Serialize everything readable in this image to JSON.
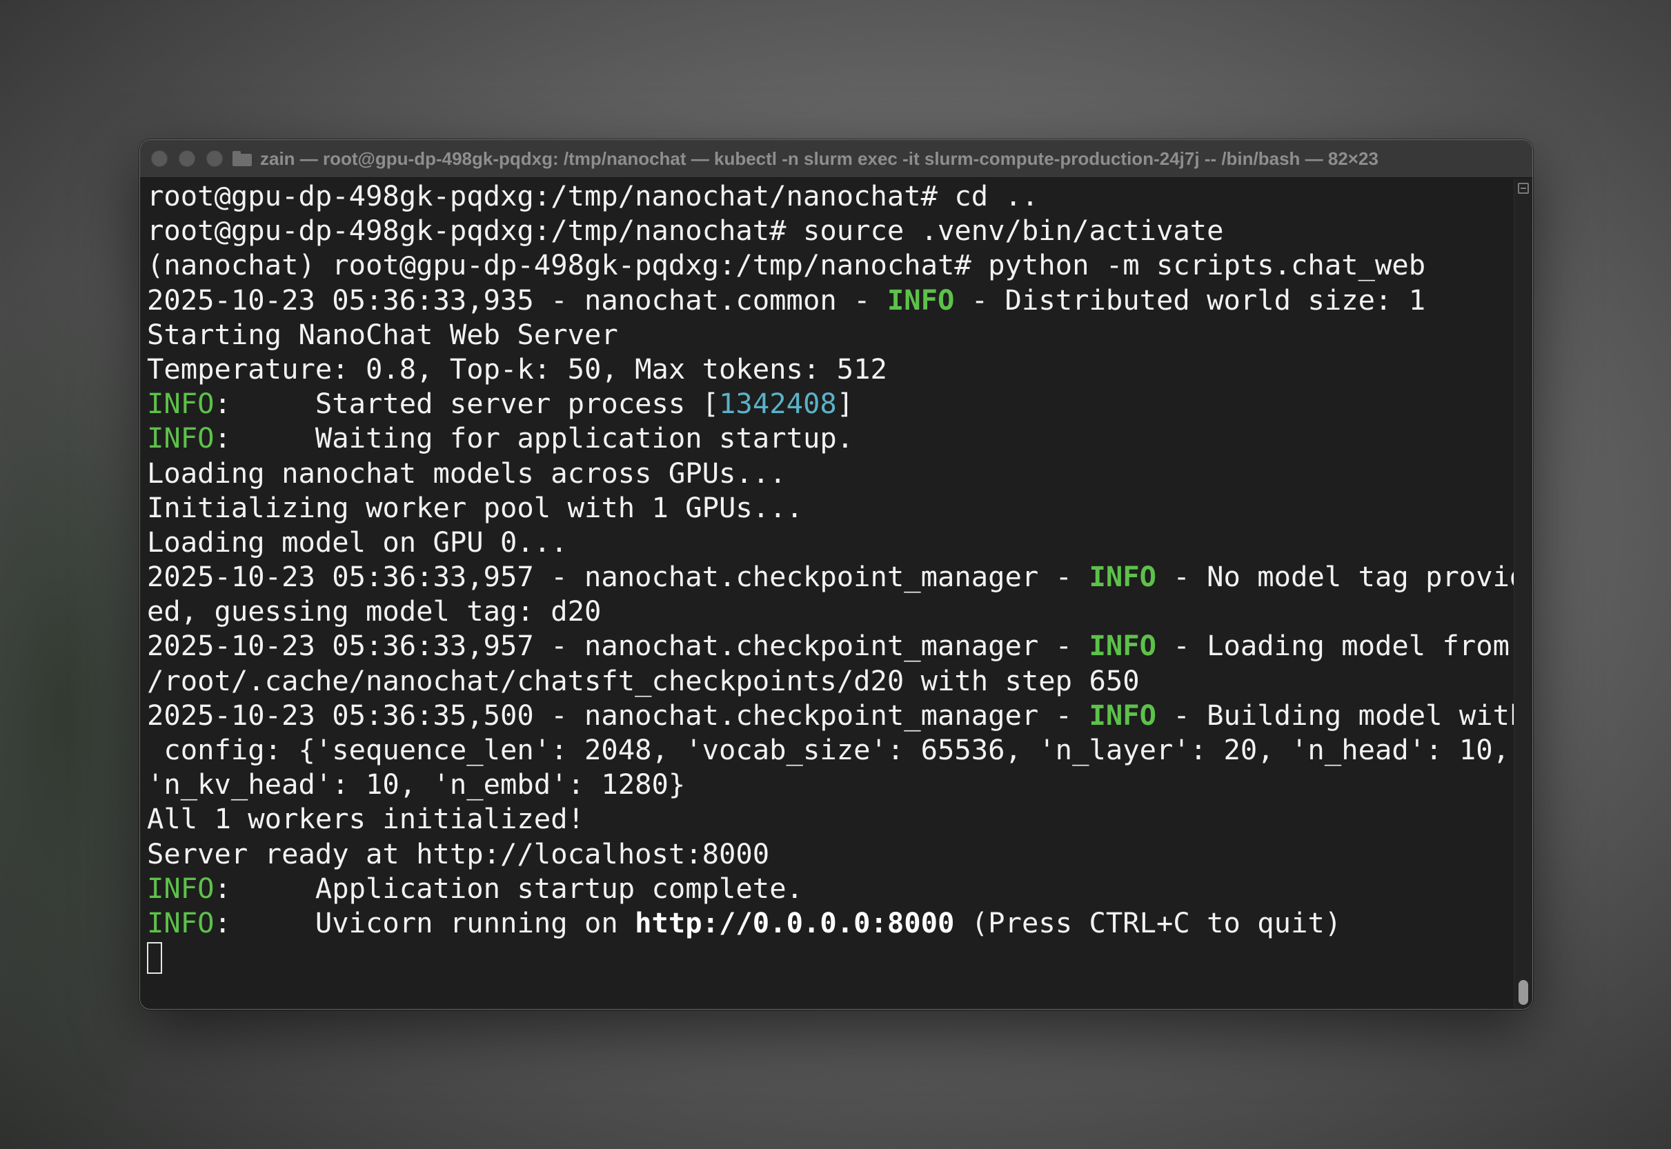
{
  "window": {
    "title": "zain — root@gpu-dp-498gk-pqdxg: /tmp/nanochat — kubectl -n slurm exec -it slurm-compute-production-24j7j -- /bin/bash — 82×23"
  },
  "terminal": {
    "lines": [
      {
        "text": "root@gpu-dp-498gk-pqdxg:/tmp/nanochat/nanochat# cd .."
      },
      {
        "text": "root@gpu-dp-498gk-pqdxg:/tmp/nanochat# source .venv/bin/activate"
      },
      {
        "text": "(nanochat) root@gpu-dp-498gk-pqdxg:/tmp/nanochat# python -m scripts.chat_web"
      },
      {
        "pre": "2025-10-23 05:36:33,935 - nanochat.common - ",
        "level": "INFO",
        "post": " - Distributed world size: 1"
      },
      {
        "text": "Starting NanoChat Web Server"
      },
      {
        "text": "Temperature: 0.8, Top-k: 50, Max tokens: 512"
      },
      {
        "level": "INFO",
        "msg_pre": ":     Started server process [",
        "pid": "1342408",
        "msg_post": "]"
      },
      {
        "level": "INFO",
        "msg": ":     Waiting for application startup."
      },
      {
        "text": "Loading nanochat models across GPUs..."
      },
      {
        "text": "Initializing worker pool with 1 GPUs..."
      },
      {
        "text": "Loading model on GPU 0..."
      },
      {
        "pre": "2025-10-23 05:36:33,957 - nanochat.checkpoint_manager - ",
        "level": "INFO",
        "post": " - No model tag provid"
      },
      {
        "text": "ed, guessing model tag: d20"
      },
      {
        "pre": "2025-10-23 05:36:33,957 - nanochat.checkpoint_manager - ",
        "level": "INFO",
        "post": " - Loading model from"
      },
      {
        "text": "/root/.cache/nanochat/chatsft_checkpoints/d20 with step 650"
      },
      {
        "pre": "2025-10-23 05:36:35,500 - nanochat.checkpoint_manager - ",
        "level": "INFO",
        "post": " - Building model with"
      },
      {
        "text": " config: {'sequence_len': 2048, 'vocab_size': 65536, 'n_layer': 20, 'n_head': 10,"
      },
      {
        "text": "'n_kv_head': 10, 'n_embd': 1280}"
      },
      {
        "text": "All 1 workers initialized!"
      },
      {
        "text": "Server ready at http://localhost:8000"
      },
      {
        "level": "INFO",
        "msg": ":     Application startup complete."
      },
      {
        "level": "INFO",
        "msg_pre": ":     Uvicorn running on ",
        "url": "http://0.0.0.0:8000",
        "msg_post": " (Press CTRL+C to quit)"
      }
    ]
  },
  "colors": {
    "info_green": "#5dc14a",
    "pid_cyan": "#5ab2c8",
    "terminal_bg": "#1e1e1e",
    "terminal_fg": "#f2f2f2"
  },
  "icons": {
    "traffic_lights": [
      "close-button",
      "minimize-button",
      "zoom-button"
    ],
    "title_icon": "folder-icon",
    "scroll_button": "scroll-marks-icon"
  }
}
